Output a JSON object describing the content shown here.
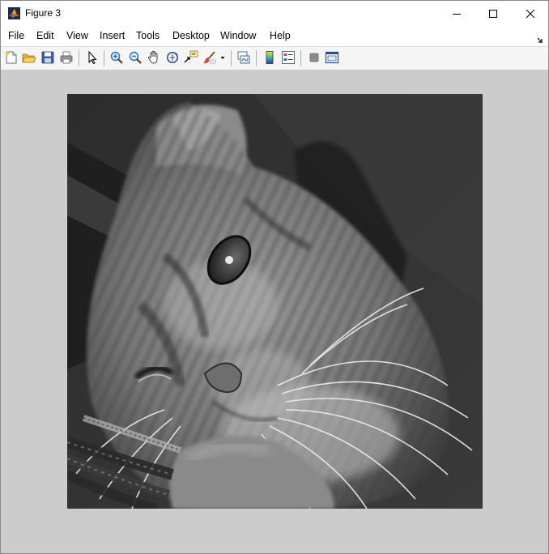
{
  "window": {
    "title": "Figure 3",
    "app_icon": "matlab-logo-icon",
    "controls": [
      "minimize-icon",
      "maximize-icon",
      "close-icon"
    ]
  },
  "menubar": {
    "items": [
      "File",
      "Edit",
      "View",
      "Insert",
      "Tools",
      "Desktop",
      "Window",
      "Help"
    ]
  },
  "toolbar": {
    "buttons": [
      "new-figure-icon",
      "open-file-icon",
      "save-figure-icon",
      "print-figure-icon",
      "edit-plot-arrow-icon",
      "zoom-in-icon",
      "zoom-out-icon",
      "pan-hand-icon",
      "rotate-3d-icon",
      "data-cursor-icon",
      "brush-icon",
      "brush-dropdown-icon",
      "link-plot-icon",
      "insert-colorbar-icon",
      "insert-legend-icon",
      "hide-plot-tools-icon",
      "show-plot-tools-icon"
    ]
  },
  "figure": {
    "background_color": "#cccccc",
    "image_content": "grayscale photo of a tabby kitten resting its head sideways",
    "colormap": "gray"
  }
}
